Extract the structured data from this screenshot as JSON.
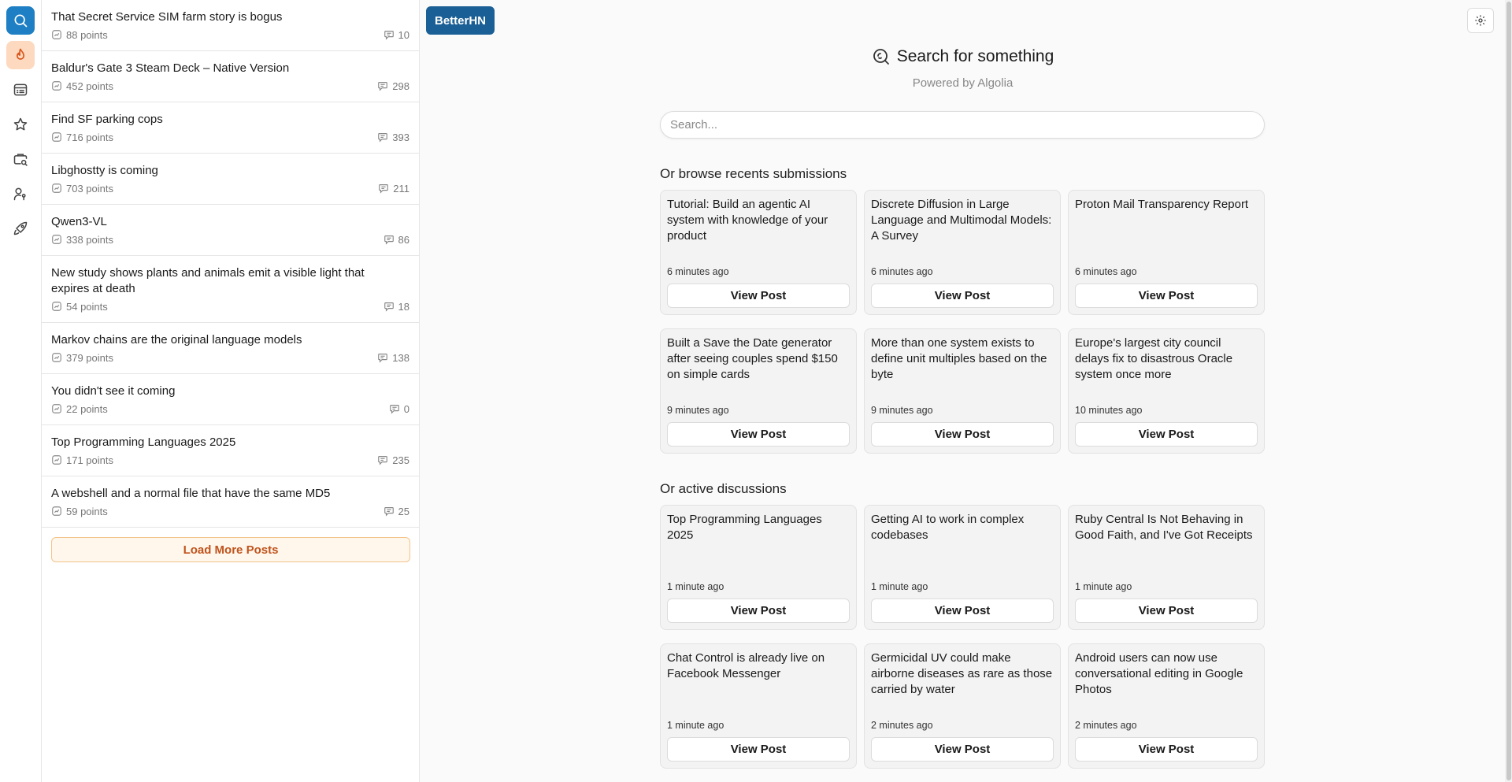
{
  "rail": {
    "items": [
      {
        "name": "search",
        "icon": "search-icon"
      },
      {
        "name": "hot",
        "icon": "flame-icon"
      },
      {
        "name": "news",
        "icon": "list-icon"
      },
      {
        "name": "favorites",
        "icon": "star-icon"
      },
      {
        "name": "jobs",
        "icon": "briefcase-search-icon"
      },
      {
        "name": "users",
        "icon": "user-key-icon"
      },
      {
        "name": "launch",
        "icon": "rocket-icon"
      }
    ]
  },
  "posts": [
    {
      "title": "That Secret Service SIM farm story is bogus",
      "points": "88 points",
      "comments": "10"
    },
    {
      "title": "Baldur's Gate 3 Steam Deck – Native Version",
      "points": "452 points",
      "comments": "298"
    },
    {
      "title": "Find SF parking cops",
      "points": "716 points",
      "comments": "393"
    },
    {
      "title": "Libghostty is coming",
      "points": "703 points",
      "comments": "211"
    },
    {
      "title": "Qwen3-VL",
      "points": "338 points",
      "comments": "86"
    },
    {
      "title": "New study shows plants and animals emit a visible light that expires at death",
      "points": "54 points",
      "comments": "18"
    },
    {
      "title": "Markov chains are the original language models",
      "points": "379 points",
      "comments": "138"
    },
    {
      "title": "You didn't see it coming",
      "points": "22 points",
      "comments": "0"
    },
    {
      "title": "Top Programming Languages 2025",
      "points": "171 points",
      "comments": "235"
    },
    {
      "title": "A webshell and a normal file that have the same MD5",
      "points": "59 points",
      "comments": "25"
    }
  ],
  "load_more_label": "Load More Posts",
  "brand": "BetterHN",
  "hero": {
    "title": "Search for something",
    "subtitle": "Powered by Algolia"
  },
  "search": {
    "placeholder": "Search..."
  },
  "recent": {
    "heading": "Or browse recents submissions",
    "cards": [
      {
        "title": "Tutorial: Build an agentic AI system with knowledge of your product",
        "time": "6 minutes ago",
        "button": "View Post"
      },
      {
        "title": "Discrete Diffusion in Large Language and Multimodal Models: A Survey",
        "time": "6 minutes ago",
        "button": "View Post"
      },
      {
        "title": "Proton Mail Transparency Report",
        "time": "6 minutes ago",
        "button": "View Post"
      },
      {
        "title": "Built a Save the Date generator after seeing couples spend $150 on simple cards",
        "time": "9 minutes ago",
        "button": "View Post"
      },
      {
        "title": "More than one system exists to define unit multiples based on the byte",
        "time": "9 minutes ago",
        "button": "View Post"
      },
      {
        "title": "Europe's largest city council delays fix to disastrous Oracle system once more",
        "time": "10 minutes ago",
        "button": "View Post"
      }
    ]
  },
  "active": {
    "heading": "Or active discussions",
    "cards": [
      {
        "title": "Top Programming Languages 2025",
        "time": "1 minute ago",
        "button": "View Post"
      },
      {
        "title": "Getting AI to work in complex codebases",
        "time": "1 minute ago",
        "button": "View Post"
      },
      {
        "title": "Ruby Central Is Not Behaving in Good Faith, and I've Got Receipts",
        "time": "1 minute ago",
        "button": "View Post"
      },
      {
        "title": "Chat Control is already live on Facebook Messenger",
        "time": "1 minute ago",
        "button": "View Post"
      },
      {
        "title": "Germicidal UV could make airborne diseases as rare as those carried by water",
        "time": "2 minutes ago",
        "button": "View Post"
      },
      {
        "title": "Android users can now use conversational editing in Google Photos",
        "time": "2 minutes ago",
        "button": "View Post"
      }
    ]
  }
}
